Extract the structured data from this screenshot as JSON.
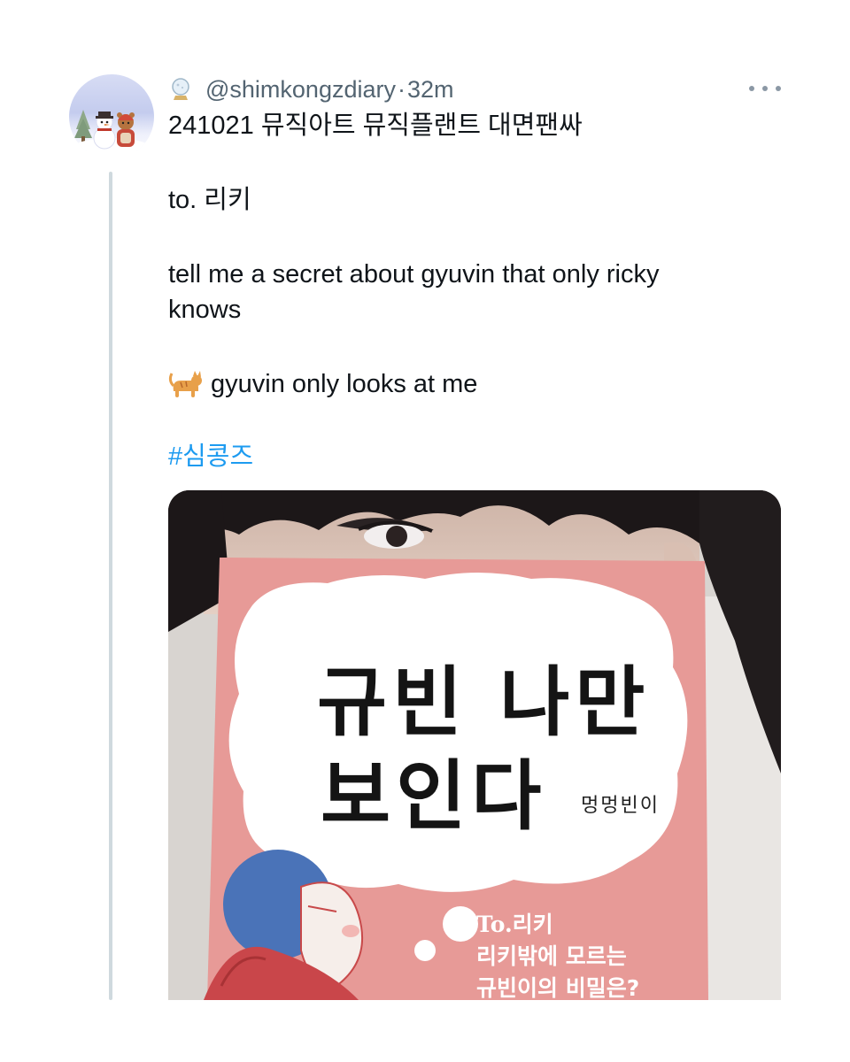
{
  "tweet": {
    "handle": "@shimkongzdiary",
    "separator": "·",
    "time": "32m",
    "lines": {
      "title": "241021 뮤직아트 뮤직플랜트 대면팬싸",
      "to": "to. 리키",
      "question_1": "tell me a secret about gyuvin that only ricky",
      "question_2": "knows",
      "answer": "gyuvin only looks at me",
      "hashtag": "#심콩즈"
    },
    "icons": {
      "header_icon": "snow-globe-icon",
      "answer_icon": "cat-emoji-icon",
      "more_icon": "more-options-icon"
    }
  },
  "photo": {
    "handwriting_line_1": "규빈 나만",
    "handwriting_line_2": "보인다",
    "signature": "멍멍빈이",
    "card_to": "To.리키",
    "card_line_1": "리키밖에 모르는",
    "card_line_2": "규빈이의 비밀은?"
  },
  "colors": {
    "link": "#1d9bf0",
    "secondary": "#536471",
    "card_pink": "#e79a97",
    "thread_line": "#cfd9de"
  }
}
